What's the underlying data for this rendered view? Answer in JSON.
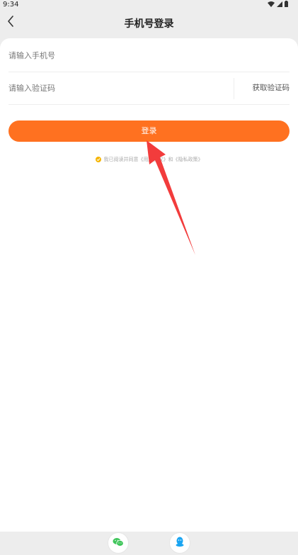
{
  "status_bar": {
    "time": "9:34"
  },
  "header": {
    "title": "手机号登录"
  },
  "form": {
    "phone_placeholder": "请输入手机号",
    "code_placeholder": "请输入验证码",
    "get_code_label": "获取验证码",
    "login_label": "登录"
  },
  "agreement": {
    "text": "我已阅读并同意《用户协议》和《隐私政策》"
  },
  "colors": {
    "accent": "#ff7120",
    "check": "#f5b400",
    "annotation_arrow": "#f23c3c",
    "wechat": "#3fc55a",
    "qq": "#1aa5f2"
  },
  "icons": {
    "back": "chevron-left-icon",
    "wechat": "wechat-icon",
    "qq": "qq-icon"
  }
}
